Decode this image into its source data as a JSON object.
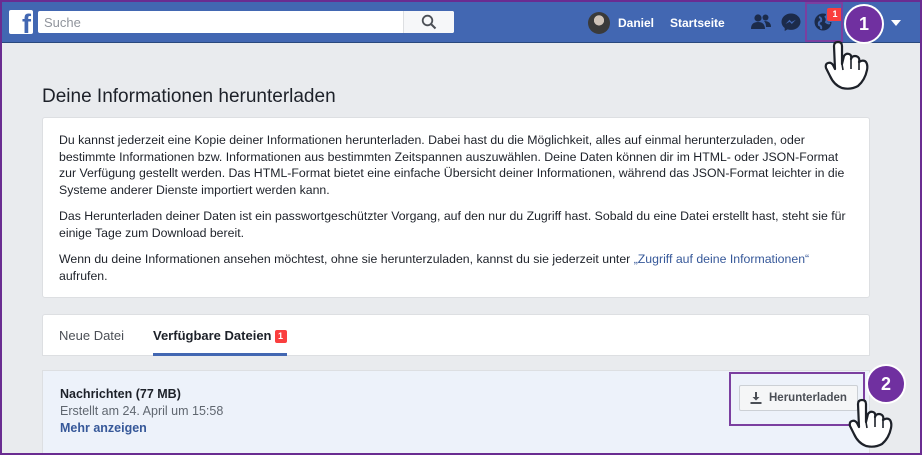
{
  "header": {
    "search": {
      "placeholder": "Suche",
      "value": ""
    },
    "user": {
      "name": "Daniel"
    },
    "home_label": "Startseite",
    "notification_count": "1"
  },
  "annotations": {
    "step1": "1",
    "step2": "2"
  },
  "main": {
    "title": "Deine Informationen herunterladen",
    "info": {
      "p1": "Du kannst jederzeit eine Kopie deiner Informationen herunterladen. Dabei hast du die Möglichkeit, alles auf einmal herunterzuladen, oder bestimmte Informationen bzw. Informationen aus bestimmten Zeitspannen auszuwählen. Deine Daten können dir im HTML- oder JSON-Format zur Verfügung gestellt werden. Das HTML-Format bietet eine einfache Übersicht deiner Informationen, während das JSON-Format leichter in die Systeme anderer Dienste importiert werden kann.",
      "p2": "Das Herunterladen deiner Daten ist ein passwortgeschützter Vorgang, auf den nur du Zugriff hast. Sobald du eine Datei erstellt hast, steht sie für einige Tage zum Download bereit.",
      "p3_before": "Wenn du deine Informationen ansehen möchtest, ohne sie herunterzuladen, kannst du sie jederzeit unter ",
      "p3_link": "„Zugriff auf deine Informationen“",
      "p3_after": " aufrufen."
    },
    "tabs": [
      {
        "label": "Neue Datei"
      },
      {
        "label": "Verfügbare Dateien",
        "badge": "1"
      }
    ],
    "file": {
      "name": "Nachrichten (77 MB)",
      "created": "Erstellt am 24. April um 15:58",
      "more_label": "Mehr anzeigen",
      "download_label": "Herunterladen"
    }
  },
  "colors": {
    "brand": "#4267b2",
    "annotation": "#7030a0",
    "badge": "#fa3e3e",
    "link": "#365899"
  },
  "icons": [
    "facebook-logo-icon",
    "search-icon",
    "friends-icon",
    "messenger-icon",
    "globe-notification-icon",
    "caret-down-icon",
    "download-icon",
    "hand-pointer-icon"
  ]
}
